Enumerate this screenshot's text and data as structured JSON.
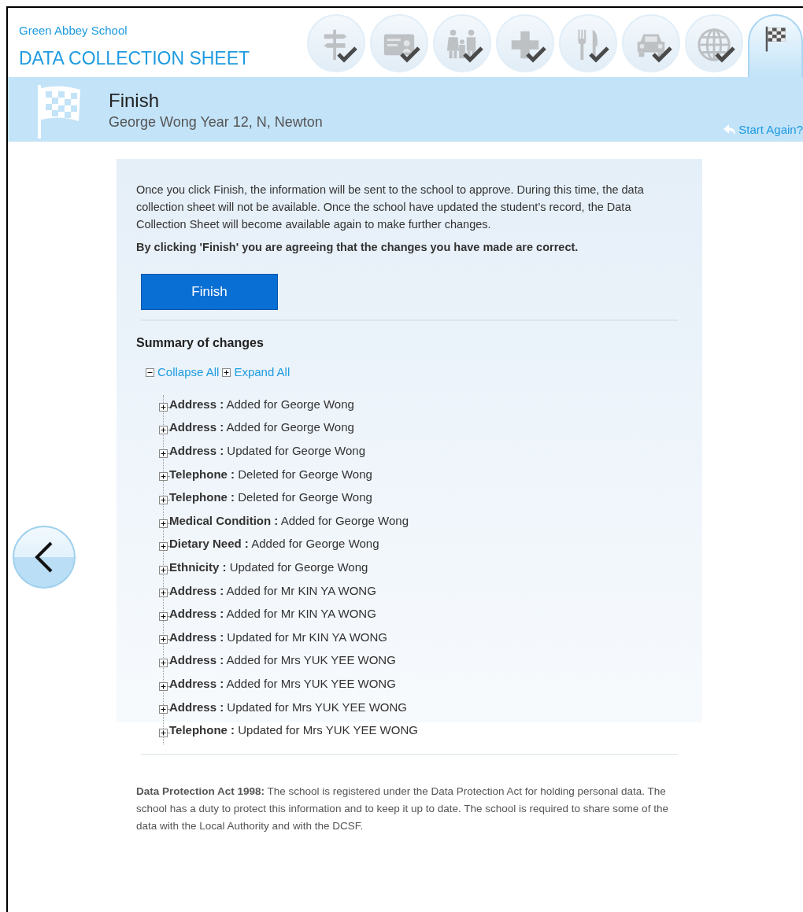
{
  "header": {
    "school": "Green Abbey School",
    "title": "DATA COLLECTION SHEET"
  },
  "steps": [
    {
      "kind": "signpost",
      "completed": true,
      "selected": false
    },
    {
      "kind": "card",
      "completed": true,
      "selected": false
    },
    {
      "kind": "family",
      "completed": true,
      "selected": false
    },
    {
      "kind": "medical",
      "completed": true,
      "selected": false
    },
    {
      "kind": "dietary",
      "completed": true,
      "selected": false
    },
    {
      "kind": "car",
      "completed": true,
      "selected": false
    },
    {
      "kind": "globe",
      "completed": true,
      "selected": false
    },
    {
      "kind": "flag",
      "completed": false,
      "selected": true
    }
  ],
  "banner": {
    "title": "Finish",
    "subtitle": "George Wong Year 12, N, Newton",
    "start_again": "Start Again?"
  },
  "intro": "Once you click Finish, the information will be sent to the school to approve. During this time, the data collection sheet will not be available. Once the school have updated the student’s record, the Data Collection Sheet will become available again to make further changes.",
  "agreement": "By clicking 'Finish' you are agreeing that the changes you have made are correct.",
  "finish_button": "Finish",
  "summary": {
    "title": "Summary of changes",
    "collapse_all": "Collapse All",
    "expand_all": "Expand All",
    "items": [
      {
        "text": "**Address :** Added for George Wong",
        "expanded": false
      },
      {
        "text": "**Address :** Added for George Wong",
        "expanded": false
      },
      {
        "text": "**Address :** Updated for George Wong",
        "expanded": false
      },
      {
        "text": "**Telephone :** Deleted for George Wong",
        "expanded": false
      },
      {
        "text": "**Telephone :** Deleted for George Wong",
        "expanded": false
      },
      {
        "text": "**Medical Condition :** Added for George Wong",
        "expanded": false
      },
      {
        "text": "**Dietary Need :** Added for George Wong",
        "expanded": false
      },
      {
        "text": "**Ethnicity :** Updated for George Wong",
        "expanded": false
      },
      {
        "text": "**Address :** Added for Mr KIN YA WONG",
        "expanded": false
      },
      {
        "text": "**Address :** Added for Mr KIN YA WONG",
        "expanded": false
      },
      {
        "text": "**Address :** Updated for Mr KIN YA WONG",
        "expanded": false
      },
      {
        "text": "**Address :** Added for Mrs YUK YEE WONG",
        "expanded": false
      },
      {
        "text": "**Address :** Added for Mrs YUK YEE WONG",
        "expanded": false
      },
      {
        "text": "**Address :** Updated for Mrs YUK YEE WONG",
        "expanded": false
      },
      {
        "text": "**Telephone :** Updated for Mrs YUK YEE WONG",
        "expanded": false
      }
    ]
  },
  "footer": "**Data Protection Act 1998:** The school is registered under the Data Protection Act for holding personal data. The school has a duty to protect this information and to keep it up to date. The school is required to share some of the data with the Local Authority and with the DCSF."
}
